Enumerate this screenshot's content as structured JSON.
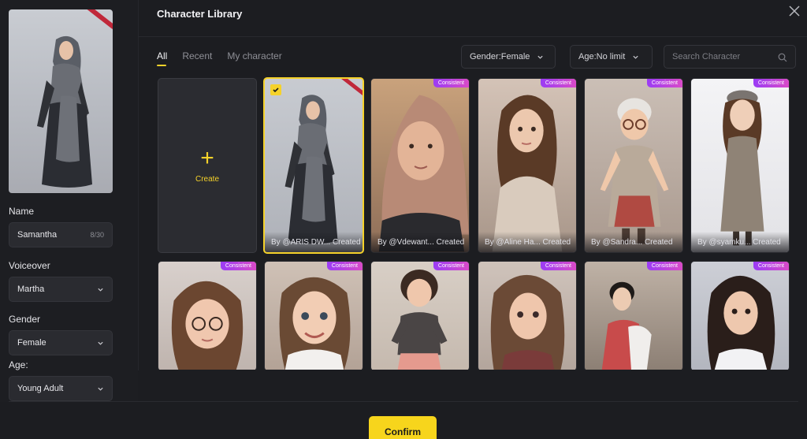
{
  "header": {
    "title": "Character Library"
  },
  "left_panel": {
    "name_label": "Name",
    "name_value": "Samantha",
    "name_count": "8/30",
    "voiceover_label": "Voiceover",
    "voiceover_value": "Martha",
    "gender_label": "Gender",
    "gender_value": "Female",
    "age_label": "Age:",
    "age_value": "Young Adult"
  },
  "tabs": [
    {
      "label": "All",
      "active": true
    },
    {
      "label": "Recent",
      "active": false
    },
    {
      "label": "My character",
      "active": false
    }
  ],
  "filters": {
    "gender": "Gender:Female",
    "age": "Age:No limit",
    "search_placeholder": "Search Character"
  },
  "create_label": "Create",
  "badge_label": "Consistent",
  "cards_row1": [
    {
      "byline": "By @ARIS DW... Created",
      "selected": true,
      "badge": false
    },
    {
      "byline": "By @Vdewant... Created",
      "selected": false,
      "badge": true
    },
    {
      "byline": "By @Aline Ha... Created",
      "selected": false,
      "badge": true
    },
    {
      "byline": "By @Sandra... Created",
      "selected": false,
      "badge": true
    },
    {
      "byline": "By @syamku... Created",
      "selected": false,
      "badge": true
    }
  ],
  "cards_row2": [
    {
      "badge": true
    },
    {
      "badge": true
    },
    {
      "badge": true
    },
    {
      "badge": true
    },
    {
      "badge": true
    },
    {
      "badge": true
    }
  ],
  "confirm_label": "Confirm",
  "colors": {
    "accent": "#f5d22a",
    "badge_from": "#9b3cf5",
    "badge_to": "#d94ac8",
    "panel": "#1c1d21"
  }
}
